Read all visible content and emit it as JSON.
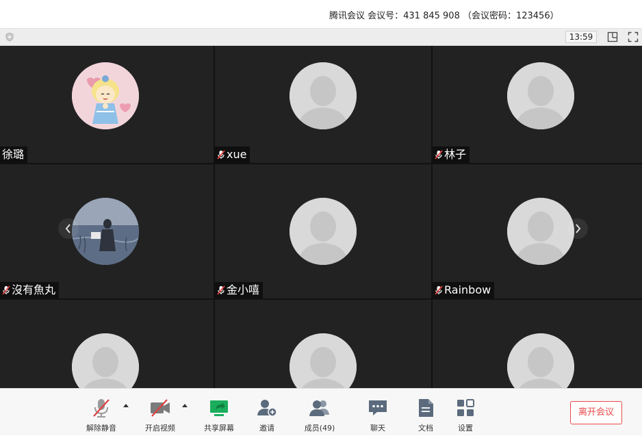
{
  "header": {
    "title": "腾讯会议 会议号：431 845 908 （会议密码：123456）"
  },
  "status": {
    "timer": "13:59"
  },
  "participants": [
    {
      "name": "徐璐",
      "muted": false,
      "avatar": "cartoon-girl"
    },
    {
      "name": "xue",
      "muted": true,
      "avatar": "default"
    },
    {
      "name": "林子",
      "muted": true,
      "avatar": "default"
    },
    {
      "name": "沒有魚丸",
      "muted": true,
      "avatar": "photo-lake"
    },
    {
      "name": "金小嘻",
      "muted": true,
      "avatar": "default"
    },
    {
      "name": "Rainbow",
      "muted": true,
      "avatar": "default"
    },
    {
      "name": "",
      "muted": false,
      "avatar": "default"
    },
    {
      "name": "",
      "muted": false,
      "avatar": "default"
    },
    {
      "name": "",
      "muted": false,
      "avatar": "default"
    }
  ],
  "toolbar": {
    "unmute": "解除静音",
    "start_video": "开启视频",
    "share_screen": "共享屏幕",
    "invite": "邀请",
    "members": "成员(49)",
    "chat": "聊天",
    "docs": "文档",
    "settings": "设置",
    "leave": "离开会议"
  },
  "colors": {
    "tile_bg": "#222222",
    "share_green": "#1aad5c",
    "leave_red": "#e84a4a",
    "mute_red": "#e03e3e"
  }
}
